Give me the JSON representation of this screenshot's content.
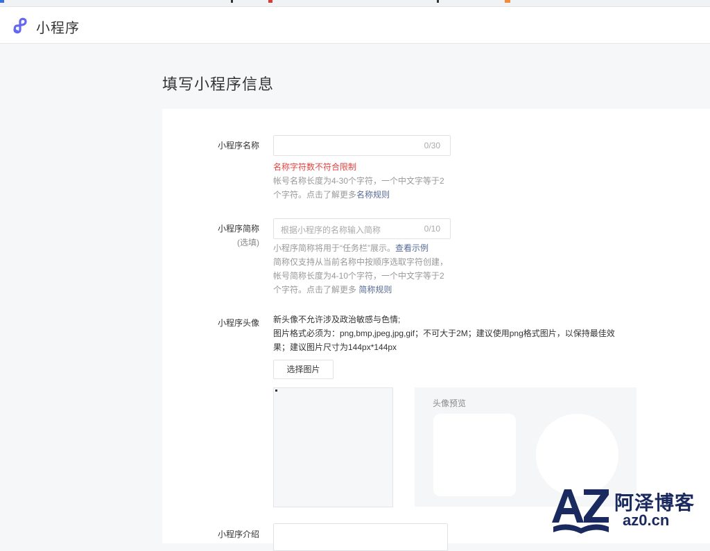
{
  "header": {
    "app_title": "小程序",
    "logo_icon": "miniprogram-logo-icon",
    "accent": "#6467f0"
  },
  "page": {
    "title": "填写小程序信息"
  },
  "form": {
    "name": {
      "label": "小程序名称",
      "value": "",
      "counter": "0/30",
      "error": "名称字符数不符合限制",
      "help_line1": "帐号名称长度为4-30个字符，一个中文字等于2",
      "help_line2": "个字符。点击了解更多",
      "help_link": "名称规则"
    },
    "short_name": {
      "label": "小程序简称",
      "sub_label": "(选填)",
      "placeholder": "根据小程序的名称输入简称",
      "counter": "0/10",
      "help_line1": "小程序简称将用于“任务栏”展示。",
      "help_link1": "查看示例",
      "help_line2": "简称仅支持从当前名称中按顺序选取字符创建，",
      "help_line3": "帐号简称长度为4-10个字符，一个中文字等于2",
      "help_line4": "个字符。点击了解更多 ",
      "help_link2": "简称规则"
    },
    "avatar": {
      "label": "小程序头像",
      "info_line1": "新头像不允许涉及政治敏感与色情;",
      "info_line2": "图片格式必须为：png,bmp,jpeg,jpg,gif；不可大于2M；建议使用png格式图片，以保持最佳效",
      "info_line3": "果；建议图片尺寸为144px*144px",
      "select_button": "选择图片",
      "preview_title": "头像预览"
    },
    "intro": {
      "label": "小程序介绍"
    }
  },
  "watermark": {
    "cn": "阿泽博客",
    "url": "az0.cn",
    "color": "#1a2a5e"
  }
}
